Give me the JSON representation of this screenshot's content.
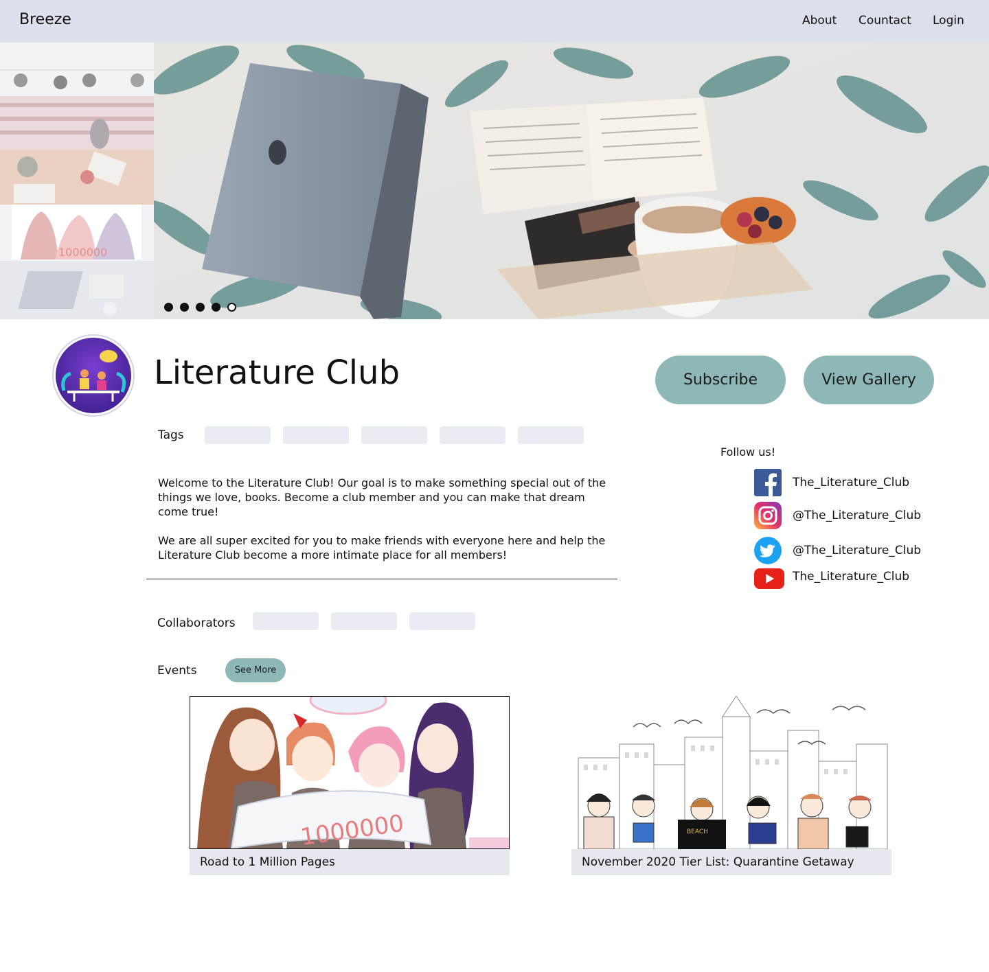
{
  "nav": {
    "brand": "Breeze",
    "links": [
      "About",
      "Countact",
      "Login"
    ]
  },
  "hero": {
    "slide_count": 5,
    "active_slide": 5
  },
  "club": {
    "name": "Literature Club",
    "subscribe_label": "Subscribe",
    "gallery_label": "View Gallery",
    "tags_label": "Tags",
    "description": [
      "Welcome to the Literature Club! Our goal is to make something special out of the things we love, books. Become a club member and you can make that dream come true!",
      "We are all super excited for you to make friends with everyone here and help the Literature Club become a more intimate place for all members!"
    ],
    "collaborators_label": "Collaborators",
    "events_label": "Events",
    "see_more_label": "See More"
  },
  "social": {
    "heading": "Follow us!",
    "items": [
      {
        "icon": "facebook-icon",
        "handle": "The_Literature_Club",
        "color": "#3b5998"
      },
      {
        "icon": "instagram-icon",
        "handle": "@The_Literature_Club",
        "color": "#c13584"
      },
      {
        "icon": "twitter-icon",
        "handle": "@The_Literature_Club",
        "color": "#1da1f2"
      },
      {
        "icon": "youtube-icon",
        "handle": "The_Literature_Club",
        "color": "#e62117"
      }
    ]
  },
  "events": [
    {
      "title": "Road to 1 Million Pages",
      "image": "anime-club-photo"
    },
    {
      "title": "November 2020 Tier List: Quarantine Getaway",
      "image": "city-readers-illustration"
    }
  ],
  "colors": {
    "nav_bg": "#dbe0ea",
    "accent": "#8db8b6",
    "placeholder": "#e9ecf2"
  }
}
